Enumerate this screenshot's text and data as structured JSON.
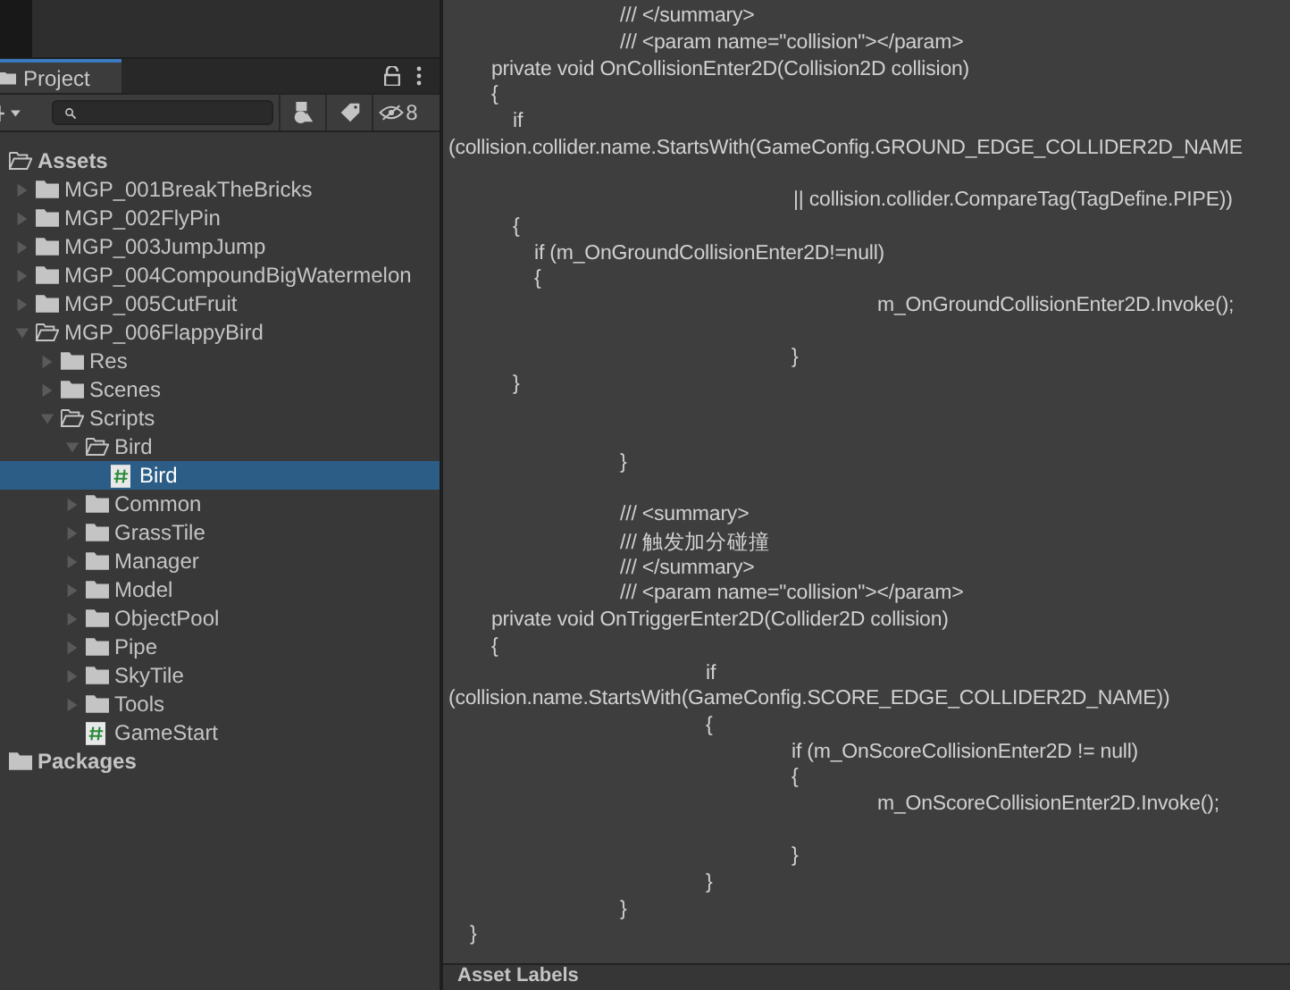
{
  "project_panel": {
    "tab": {
      "label": "Project",
      "selected": true
    },
    "hidden_count": "8",
    "tree": [
      {
        "label": "Assets",
        "kind": "folder",
        "expanded": true,
        "selected": false,
        "children": [
          {
            "label": "MGP_001BreakTheBricks",
            "kind": "folder",
            "expanded": false,
            "selected": false
          },
          {
            "label": "MGP_002FlyPin",
            "kind": "folder",
            "expanded": false,
            "selected": false
          },
          {
            "label": "MGP_003JumpJump",
            "kind": "folder",
            "expanded": false,
            "selected": false
          },
          {
            "label": "MGP_004CompoundBigWatermelon",
            "kind": "folder",
            "expanded": false,
            "selected": false
          },
          {
            "label": "MGP_005CutFruit",
            "kind": "folder",
            "expanded": false,
            "selected": false
          },
          {
            "label": "MGP_006FlappyBird",
            "kind": "folder",
            "expanded": true,
            "selected": false,
            "children": [
              {
                "label": "Res",
                "kind": "folder",
                "expanded": false,
                "selected": false
              },
              {
                "label": "Scenes",
                "kind": "folder",
                "expanded": false,
                "selected": false
              },
              {
                "label": "Scripts",
                "kind": "folder",
                "expanded": true,
                "selected": false,
                "children": [
                  {
                    "label": "Bird",
                    "kind": "folder",
                    "expanded": true,
                    "selected": false,
                    "children": [
                      {
                        "label": "Bird",
                        "kind": "script",
                        "selected": true
                      }
                    ]
                  },
                  {
                    "label": "Common",
                    "kind": "folder",
                    "expanded": false,
                    "selected": false
                  },
                  {
                    "label": "GrassTile",
                    "kind": "folder",
                    "expanded": false,
                    "selected": false
                  },
                  {
                    "label": "Manager",
                    "kind": "folder",
                    "expanded": false,
                    "selected": false
                  },
                  {
                    "label": "Model",
                    "kind": "folder",
                    "expanded": false,
                    "selected": false
                  },
                  {
                    "label": "ObjectPool",
                    "kind": "folder",
                    "expanded": false,
                    "selected": false
                  },
                  {
                    "label": "Pipe",
                    "kind": "folder",
                    "expanded": false,
                    "selected": false
                  },
                  {
                    "label": "SkyTile",
                    "kind": "folder",
                    "expanded": false,
                    "selected": false
                  },
                  {
                    "label": "Tools",
                    "kind": "folder",
                    "expanded": false,
                    "selected": false
                  },
                  {
                    "label": "GameStart",
                    "kind": "script",
                    "selected": false
                  }
                ]
              }
            ]
          }
        ]
      },
      {
        "label": "Packages",
        "kind": "folder",
        "expanded": false,
        "selected": false
      }
    ]
  },
  "code_preview": {
    "lines": [
      "/// </summary>",
      "/// <param name=\"collision\"></param>",
      "private void OnCollisionEnter2D(Collision2D collision)",
      "{",
      "if",
      "(collision.collider.name.StartsWith(GameConfig.GROUND_EDGE_COLLIDER2D_NAME",
      "|| collision.collider.CompareTag(TagDefine.PIPE))",
      "{",
      "if (m_OnGroundCollisionEnter2D!=null)",
      "{",
      "m_OnGroundCollisionEnter2D.Invoke();",
      "}",
      "}",
      "}",
      "/// <summary>",
      "/// 触发加分碰撞",
      "/// </summary>",
      "/// <param name=\"collision\"></param>",
      "private void OnTriggerEnter2D(Collider2D collision)",
      "{",
      "if",
      "(collision.name.StartsWith(GameConfig.SCORE_EDGE_COLLIDER2D_NAME))",
      "{",
      "if (m_OnScoreCollisionEnter2D != null)",
      "{",
      "m_OnScoreCollisionEnter2D.Invoke();",
      "}",
      "}",
      "}",
      "}"
    ],
    "footer": "Asset Labels"
  }
}
